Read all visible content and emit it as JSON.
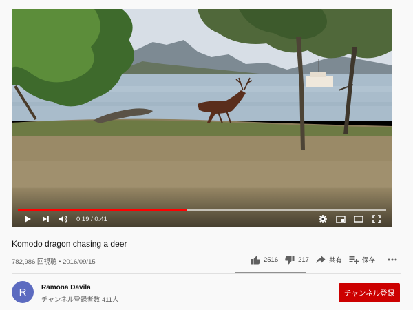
{
  "player": {
    "current_time": "0:19",
    "duration": "0:41",
    "time_separator": "/",
    "played_fraction": 0.46,
    "loaded_fraction": 1.0,
    "progress_color": "#ff0000"
  },
  "video": {
    "title": "Komodo dragon chasing a deer",
    "views": "782,986 回視聴",
    "date_separator": "•",
    "date": "2016/09/15"
  },
  "actions": {
    "likes": "2516",
    "dislikes": "217",
    "share_label": "共有",
    "save_label": "保存",
    "more_icon": "more-vert-icon"
  },
  "channel": {
    "avatar_letter": "R",
    "avatar_color": "#5c6bc0",
    "name": "Ramona Davila",
    "subscribers": "チャンネル登録者数 411人"
  },
  "subscribe": {
    "label": "チャンネル登録",
    "color": "#cc0000"
  }
}
